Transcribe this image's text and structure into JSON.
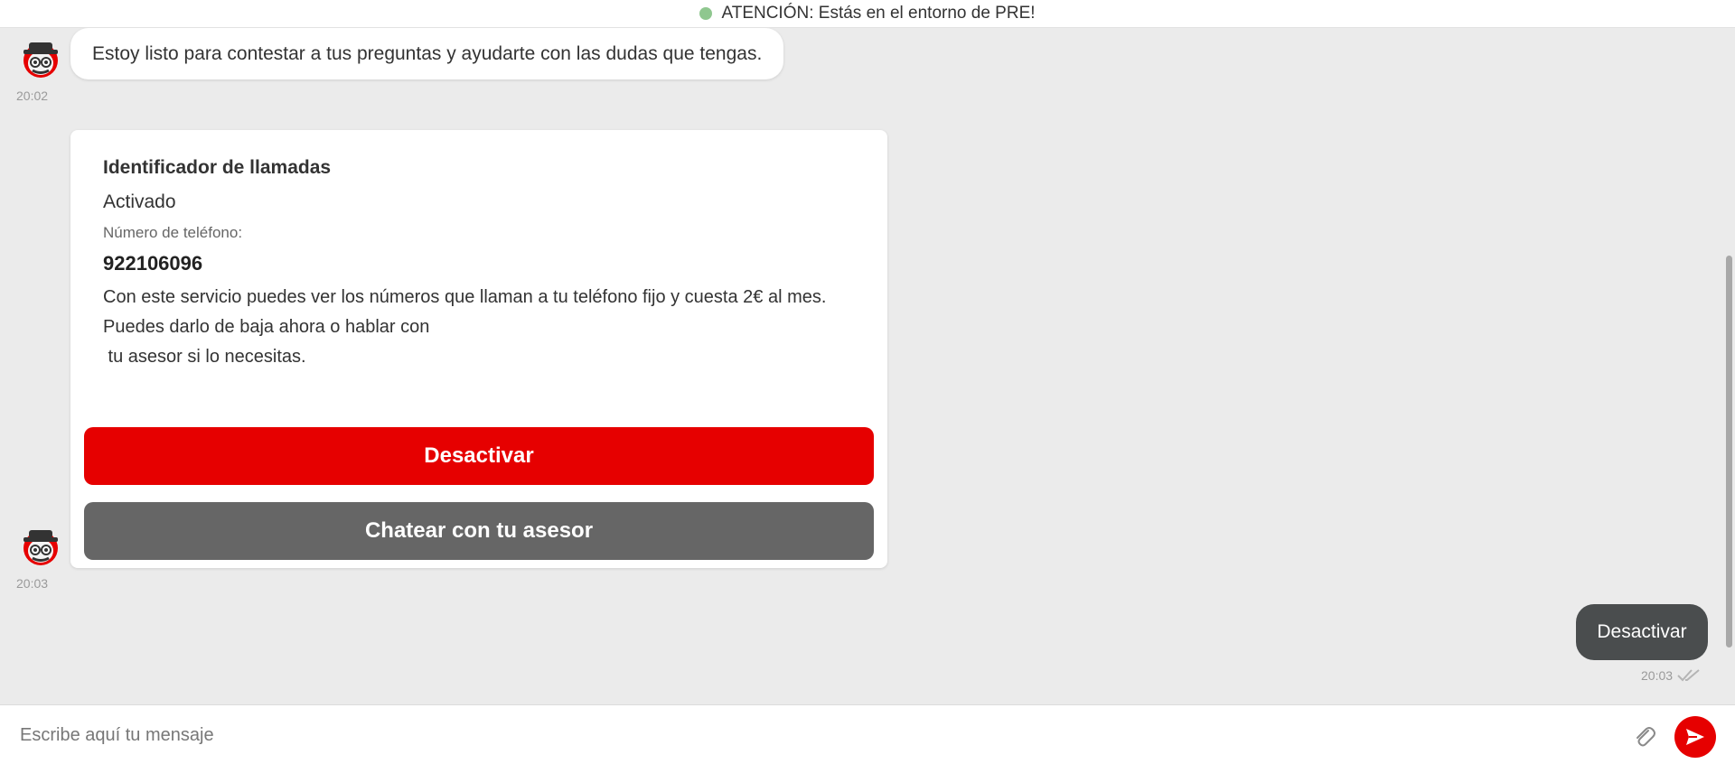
{
  "banner": {
    "text": "ATENCIÓN: Estás en el entorno de PRE!",
    "dot_color": "#8fc78f"
  },
  "messages": [
    {
      "sender": "bot",
      "text": "Estoy listo para contestar a tus preguntas y ayudarte con las dudas que tengas.",
      "time": "20:02",
      "avatar_icon": "bot-avatar-icon"
    },
    {
      "sender": "bot",
      "time": "20:03",
      "avatar_icon": "bot-avatar-icon",
      "card": {
        "title": "Identificador de llamadas",
        "status": "Activado",
        "phone_label": "Número de teléfono:",
        "phone_number": "922106096",
        "description_lines": [
          "Con este servicio puedes ver los números que llaman a tu teléfono fijo y cuesta 2€ al mes.",
          "Puedes darlo de baja ahora o hablar con",
          " tu asesor si lo necesitas."
        ],
        "buttons": [
          {
            "label": "Desactivar",
            "style": "primary",
            "color": "#e60000"
          },
          {
            "label": "Chatear con tu asesor",
            "style": "secondary",
            "color": "#666666"
          }
        ]
      }
    },
    {
      "sender": "user",
      "text": "Desactivar",
      "time": "20:03",
      "status_icon": "double-check-icon"
    }
  ],
  "composer": {
    "placeholder": "Escribe aquí tu mensaje",
    "value": "",
    "attach_icon": "paperclip-icon",
    "send_icon": "send-icon"
  },
  "colors": {
    "brand_red": "#e60000",
    "user_bubble": "#4a4d4e",
    "chat_background": "#ebebeb"
  }
}
